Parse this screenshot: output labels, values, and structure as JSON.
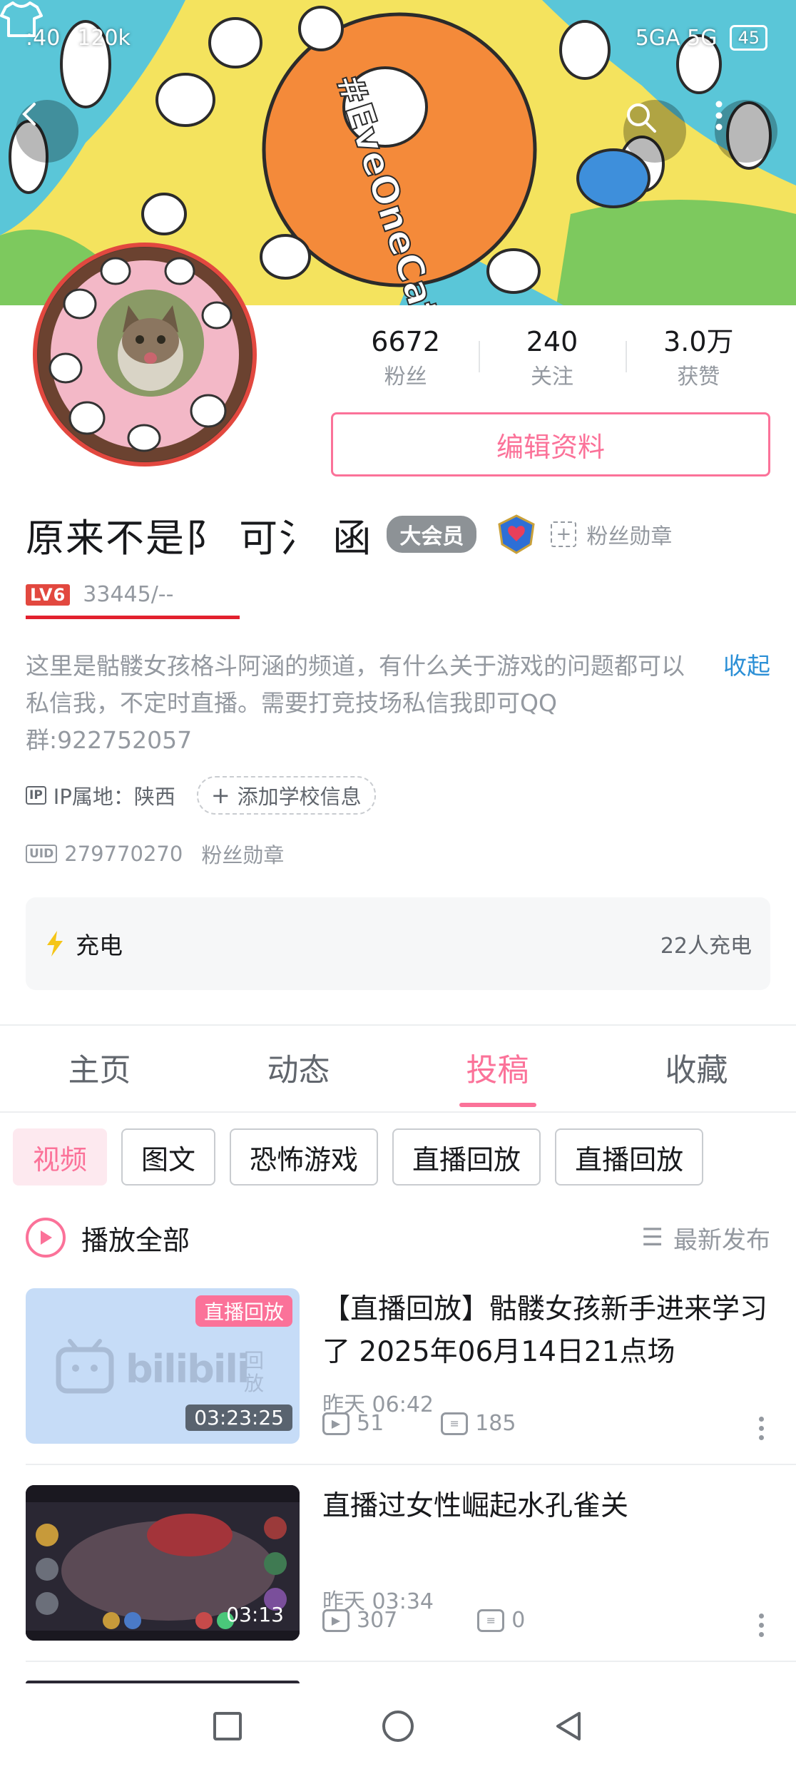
{
  "status_bar": {
    "time": ":40",
    "speed": "120k",
    "network": "5GA 5G",
    "battery": "45"
  },
  "banner": {
    "artwork_text": "#EveOneCat"
  },
  "profile": {
    "followers": {
      "value": "6672",
      "label": "粉丝"
    },
    "following": {
      "value": "240",
      "label": "关注"
    },
    "likes": {
      "value": "3.0万",
      "label": "获赞"
    },
    "edit_label": "编辑资料",
    "name": "原来不是阝 可氵 函",
    "vip_label": "大会员",
    "fan_medal_label": "粉丝勋章",
    "level": "LV6",
    "exp": "33445/--",
    "bio": "这里是骷髅女孩格斗阿涵的频道，有什么关于游戏的问题都可以私信我，不定时直播。需要打竞技场私信我即可QQ群:922752057",
    "collapse_label": "收起",
    "ip_tag": "IP",
    "ip_text": "IP属地：陕西",
    "school_label": "添加学校信息",
    "uid_tag": "UID",
    "uid": "279770270",
    "uid_medal_label": "粉丝勋章"
  },
  "charge": {
    "title": "充电",
    "count": "22人充电"
  },
  "tabs": [
    {
      "label": "主页"
    },
    {
      "label": "动态"
    },
    {
      "label": "投稿"
    },
    {
      "label": "收藏"
    }
  ],
  "chips": [
    {
      "label": "视频"
    },
    {
      "label": "图文"
    },
    {
      "label": "恐怖游戏"
    },
    {
      "label": "直播回放"
    },
    {
      "label": "直播回放"
    }
  ],
  "play_all": {
    "label": "播放全部",
    "sort_label": "最新发布"
  },
  "videos": [
    {
      "title": "【直播回放】骷髅女孩新手进来学习了 2025年06月14日21点场",
      "badge": "直播回放",
      "duration": "03:23:25",
      "time": "昨天 06:42",
      "plays": "51",
      "comments": "185",
      "placeholder_brand": "bilibili",
      "placeholder_sub": "回放"
    },
    {
      "title": "直播过女性崛起水孔雀关",
      "duration": "03:13",
      "time": "昨天 03:34",
      "plays": "307",
      "comments": "0"
    }
  ],
  "colors": {
    "accent": "#fb7299",
    "link": "#2b8fd6",
    "level": "#e2483f"
  }
}
